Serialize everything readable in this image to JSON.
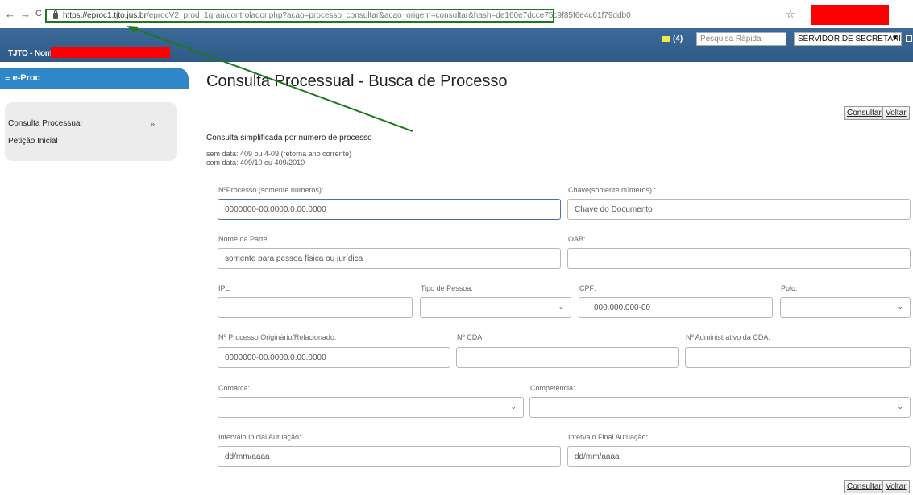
{
  "browser": {
    "back": "←",
    "forward": "→",
    "reload": "C",
    "url_domain": "https://eproc1.tjto.jus.br",
    "url_rest": "/eprocV2_prod_1grau/controlador.php?acao=processo_consultar&acao_origem=consultar&hash=de160e7dcce75c9f85f6e4c61f79ddb0",
    "star": "☆"
  },
  "header": {
    "tenant_label": "TJTO - Nome:",
    "mail_count": "(4)",
    "quick_search_placeholder": "Pesquisa Rápida",
    "role": "SERVIDOR DE SECRETARIA (T.",
    "role_arrow": "▼"
  },
  "sidebar": {
    "brand": "≡ e-Proc",
    "items": [
      {
        "label": "Consulta Processual",
        "chevron": "»"
      },
      {
        "label": "Petição Inicial"
      }
    ]
  },
  "main": {
    "title": "Consulta Processual - Busca de Processo",
    "consultar": "Consultar",
    "voltar": "Voltar",
    "section_title": "Consulta simplificada por número de processo",
    "hint_1": "sem data: 409 ou 4-09 (retorna ano corrente)",
    "hint_2": "com data: 409/10 ou 409/2010",
    "fields": {
      "nprocesso_label": "NºProcesso (somente números):",
      "nprocesso_placeholder": "0000000-00.0000.0.00.0000",
      "chave_label": "Chave(somente números) :",
      "chave_placeholder": "Chave do Documento",
      "nome_parte_label": "Nome da Parte:",
      "nome_parte_placeholder": "somente para pessoa física ou jurídica",
      "oab_label": "OAB:",
      "ipl_label": "IPL:",
      "tipo_pessoa_label": "Tipo de Pessoa:",
      "cpf_label": "CPF:",
      "cpf_placeholder": "000.000.000-00",
      "polo_label": "Polo:",
      "proc_originario_label": "Nº Processo Originário/Relacionado:",
      "proc_originario_placeholder": "0000000-00.0000.0.00.0000",
      "cda_label": "Nº CDA:",
      "adm_cda_label": "Nº Administrativo da CDA:",
      "comarca_label": "Comarca:",
      "competencia_label": "Competência:",
      "intervalo_inicial_label": "Intervalo Inicial Autuação:",
      "intervalo_inicial_placeholder": "dd/mm/aaaa",
      "intervalo_final_label": "Intervalo Final Autuação:",
      "intervalo_final_placeholder": "dd/mm/aaaa"
    },
    "chevron": "⌄"
  },
  "colors": {
    "header_blue": "#2e5a86",
    "brand_blue": "#2f87c8",
    "annotation_green": "#1c7a1c",
    "redaction_red": "#ff0000"
  }
}
